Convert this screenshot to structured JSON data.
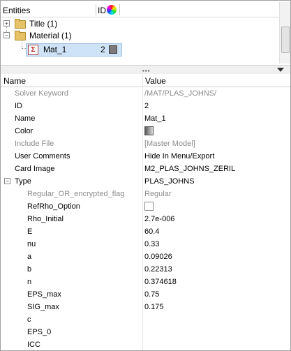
{
  "entities": {
    "header": {
      "entities_label": "Entities",
      "id_label": "ID",
      "color_icon": "color-wheel-icon"
    },
    "items": [
      {
        "label": "Title (1)",
        "expander": "+",
        "icon": "folder-icon"
      },
      {
        "label": "Material (1)",
        "expander": "−",
        "icon": "folder-icon"
      }
    ],
    "material": {
      "label": "Mat_1",
      "id": "2",
      "icon": "material-icon",
      "color": "#7a7a7a"
    }
  },
  "splitter": {
    "grip": "▪▪▪"
  },
  "grid": {
    "name_header": "Name",
    "value_header": "Value",
    "rows": [
      {
        "name": "Solver Keyword",
        "value": "/MAT/PLAS_JOHNS/"
      },
      {
        "name": "ID",
        "value": "2"
      },
      {
        "name": "Name",
        "value": "Mat_1"
      },
      {
        "name": "Color",
        "value": ""
      },
      {
        "name": "Include File",
        "value": "[Master Model]"
      },
      {
        "name": "User Comments",
        "value": "Hide In Menu/Export"
      },
      {
        "name": "Card Image",
        "value": "M2_PLAS_JOHNS_ZERIL"
      },
      {
        "name": "Type",
        "value": "PLAS_JOHNS",
        "expander": "−"
      },
      {
        "name": "Regular_OR_encrypted_flag",
        "value": "Regular"
      },
      {
        "name": "RefRho_Option",
        "value": ""
      },
      {
        "name": "Rho_Initial",
        "value": "2.7e-006"
      },
      {
        "name": "E",
        "value": "60.4"
      },
      {
        "name": "nu",
        "value": "0.33"
      },
      {
        "name": "a",
        "value": "0.09026"
      },
      {
        "name": "b",
        "value": "0.22313"
      },
      {
        "name": "n",
        "value": "0.374618"
      },
      {
        "name": "EPS_max",
        "value": "0.75"
      },
      {
        "name": "SIG_max",
        "value": "0.175"
      },
      {
        "name": "c",
        "value": ""
      },
      {
        "name": "EPS_0",
        "value": ""
      },
      {
        "name": "ICC",
        "value": ""
      }
    ]
  }
}
